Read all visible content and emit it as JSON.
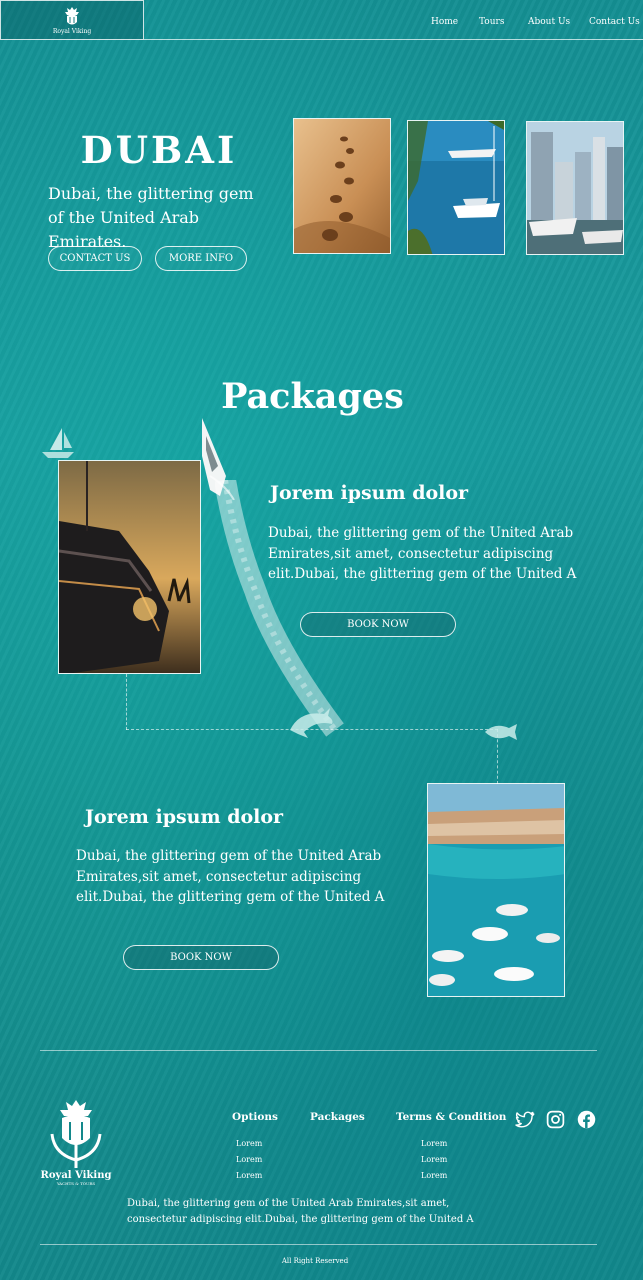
{
  "brand": {
    "name": "Royal Viking",
    "tagline": "YACHTS & TOURS"
  },
  "nav": {
    "home": "Home",
    "tours": "Tours",
    "about": "About Us",
    "contact": "Contact Us"
  },
  "hero": {
    "title": "DUBAI",
    "subtitle": "Dubai, the glittering gem of the United Arab Emirates.",
    "contact_button": "CONTACT US",
    "more_button": "MORE INFO"
  },
  "packages": {
    "title": "Packages",
    "items": [
      {
        "title": "Jorem ipsum dolor",
        "text": "Dubai, the glittering gem of the United Arab Emirates,sit amet, consectetur adipiscing elit.Dubai, the glittering gem of the United A",
        "button": "BOOK NOW"
      },
      {
        "title": "Jorem ipsum dolor",
        "text": "Dubai, the glittering gem of the United Arab Emirates,sit amet, consectetur adipiscing elit.Dubai, the glittering gem of the United A",
        "button": "BOOK NOW"
      }
    ]
  },
  "footer": {
    "brand": "Royal Viking",
    "tagline": "YACHTS & TOURS",
    "options_heading": "Options",
    "packages_heading": "Packages",
    "terms_heading": "Terms & Condition",
    "options_items": [
      "Lorem",
      "Lorem",
      "Lorem"
    ],
    "terms_items": [
      "Lorem",
      "Lorem",
      "Lorem"
    ],
    "description": "Dubai, the glittering gem of the United Arab Emirates,sit amet, consectetur adipiscing elit.Dubai, the glittering gem of the United A",
    "copyright": "All Right Reserved",
    "social": [
      "twitter-icon",
      "instagram-icon",
      "facebook-icon"
    ]
  },
  "colors": {
    "sea": "#15918f",
    "accent": "#ffffff"
  }
}
